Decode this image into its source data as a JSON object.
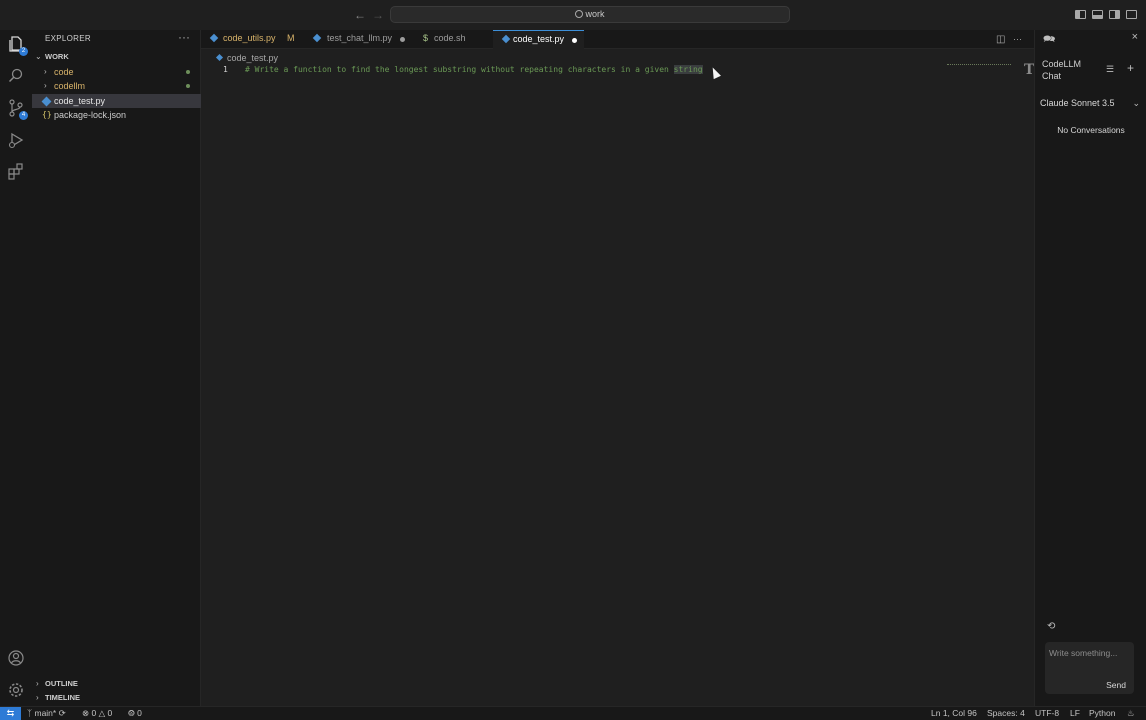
{
  "titlebar": {
    "back_icon": "arrow-left-icon",
    "forward_icon": "arrow-right-icon",
    "search_text": "work"
  },
  "activity_bar": {
    "explorer_badge": "2",
    "source_control_badge": "4"
  },
  "sidebar": {
    "title": "EXPLORER",
    "more": "···",
    "workspace": "WORK",
    "items": [
      {
        "label": "code",
        "type": "folder",
        "modified": true
      },
      {
        "label": "codellm",
        "type": "folder",
        "modified": true
      },
      {
        "label": "code_test.py",
        "type": "python",
        "selected": true
      },
      {
        "label": "package-lock.json",
        "type": "json"
      }
    ],
    "outline": "OUTLINE",
    "timeline": "TIMELINE"
  },
  "tabs": [
    {
      "label": "code_utils.py",
      "flag": "M",
      "icon": "python-icon",
      "color": "#d8b36a"
    },
    {
      "label": "test_chat_llm.py",
      "icon": "python-icon",
      "dirty": true
    },
    {
      "label": "code.sh",
      "icon": "dollar-icon"
    },
    {
      "label": "code_test.py",
      "icon": "python-icon",
      "dirty": true,
      "active": true
    }
  ],
  "editor": {
    "breadcrumb": "code_test.py",
    "line_number": "1",
    "code_prefix": "# Write a function to find the longest substring without repeating characters in a given ",
    "code_highlight": "string"
  },
  "chat": {
    "title": "CodeLLM Chat",
    "model": "Claude Sonnet 3.5",
    "empty_state": "No Conversations",
    "input_placeholder": "Write something...",
    "send_label": "Send"
  },
  "status": {
    "branch": "main*",
    "errors": "0",
    "warnings": "0",
    "ports": "0",
    "position": "Ln 1, Col 96",
    "spaces": "Spaces: 4",
    "encoding": "UTF-8",
    "eol": "LF",
    "language": "Python"
  },
  "colors": {
    "accent": "#2e7bd6",
    "comment": "#6a9955",
    "modified": "#d8b36a"
  }
}
